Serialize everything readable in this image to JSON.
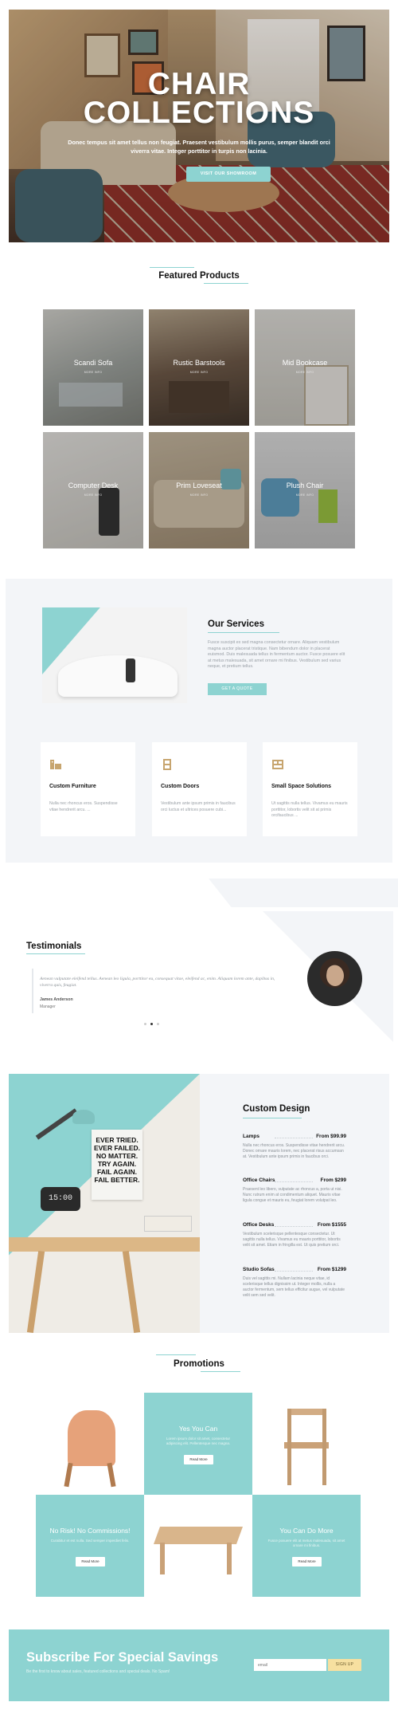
{
  "colors": {
    "accent": "#8dd3d1",
    "light_bg": "#f3f5f8",
    "button_yellow": "#f7e0a0"
  },
  "hero": {
    "title": "CHAIR\nCOLLECTIONS",
    "text": "Donec tempus sit amet tellus non feugiat. Praesent vestibulum mollis purus, semper blandit orci viverra vitae. Integer porttitor in turpis non lacinia.",
    "button": "VISIT OUR SHOWROOM"
  },
  "featured": {
    "title": "Featured Products",
    "products": [
      {
        "name": "Scandi Sofa",
        "sub": "MORE INFO"
      },
      {
        "name": "Rustic Barstools",
        "sub": "MORE INFO"
      },
      {
        "name": "Mid Bookcase",
        "sub": "MORE INFO"
      },
      {
        "name": "Computer Desk",
        "sub": "MORE INFO"
      },
      {
        "name": "Prim Loveseat",
        "sub": "MORE INFO"
      },
      {
        "name": "Plush Chair",
        "sub": "MORE INFO"
      }
    ]
  },
  "services": {
    "title": "Our Services",
    "text": "Fusce suscipit ex sed magna consectetur ornare. Aliquam vestibulum magna auctor placerat tristique. Nam bibendum dolor in placerat euismod. Duis malesuada tellus in fermentum auctor. Fusce posuere elit at metus malesuada, sit amet ornare mi finibus. Vestibulum sed varius neque, et pretium tellus.",
    "button": "GET A QUOTE",
    "cards": [
      {
        "title": "Custom Furniture",
        "text": "Nulla nec rhoncus eros. Suspendisse vitae hendrerit arcu. ..."
      },
      {
        "title": "Custom Doors",
        "text": "Vestibulum ante ipsum primis in faucibus orci luctus et ultrices posuere cubi..."
      },
      {
        "title": "Small Space Solutions",
        "text": "Ut sagittis nulla tellus. Vivamus eu mauris porttitor, lobortis velit sit at primis orcifaucibus ..."
      }
    ]
  },
  "testimonials": {
    "title": "Testimonials",
    "quote": "Aenean vulputate eleifend tellus. Aenean leo ligula, porttitor eu, consequat vitae, eleifend ac, enim. Aliquam lorem ante, dapibus in, viverra quis, feugiat.",
    "name": "James Anderson",
    "role": "Manager"
  },
  "custom_design": {
    "title": "Custom Design",
    "items": [
      {
        "name": "Lamps",
        "price": "From $99.99",
        "text": "Nulla nec rhoncus eros. Suspendisse vitae hendrerit arcu. Donec ornare mauris lorem, nec placerat risus accumsan at. Vestibulum ante ipsum primis in faucibus orci."
      },
      {
        "name": "Office Chairs",
        "price": "From $299",
        "text": "Praesent leo libero, vulputate ac rhoncus a, porta ut nisi. Nunc rutrum enim at condimentum aliquet. Mauris vitae ligula congue et mauris eu, feugiat lorem volutpat leo."
      },
      {
        "name": "Office Desks",
        "price": "From $1555",
        "text": "Vestibulum scelerisque pellentesque consectetur. Ut sagittis nulla tellus. Vivamus eu mauris porttitor, lobortis velit sit amet. Etiam in fringilla est. Ut quis pretium orci."
      },
      {
        "name": "Studio Sofas",
        "price": "From $1299",
        "text": "Duis vel sagittis mi. Nullam lacinia neque vitae, id scelerisque tellus dignissim ut. Integer mollis, nulla a auctor fermentum, sem tellus efficitur augue, vel vulputate velit sem sed velit."
      }
    ]
  },
  "promotions": {
    "title": "Promotions",
    "cards": [
      {
        "title": "Yes You Can",
        "text": "Lorem ipsum dolor sit amet, consectetur adipiscing elit. Pellentesque nec magna.",
        "button": "Read More"
      },
      {
        "title": "No Risk! No Commissions!",
        "text": "Curabitur et est nulla. Sed semper imperdiet felis.",
        "button": "Read More"
      },
      {
        "title": "You Can Do More",
        "text": "Fusce posuere elit at metus malesuada, sit amet ornare mi finibus.",
        "button": "Read More"
      }
    ]
  },
  "subscribe": {
    "title": "Subscribe For Special Savings",
    "text": "Be the first to know about sales, featured collections and special deals. No Spam!",
    "placeholder": "email",
    "button": "SIGN UP"
  }
}
